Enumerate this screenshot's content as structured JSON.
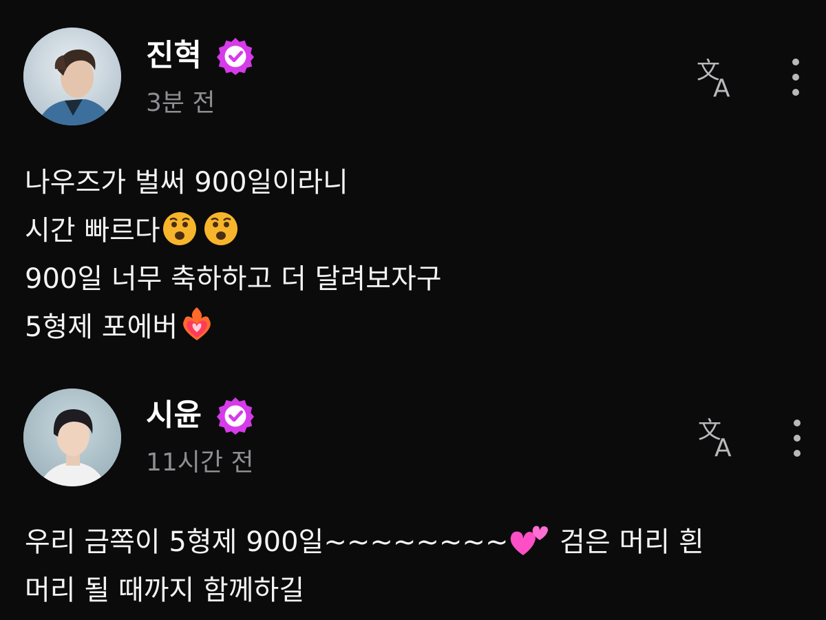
{
  "posts": [
    {
      "author": "진혁",
      "time": "3분 전",
      "lines": [
        {
          "text": "나우즈가 벌써 900일이라니",
          "emoji": []
        },
        {
          "text": "시간 빠르다",
          "emoji": [
            "anguished-face",
            "anguished-face"
          ]
        },
        {
          "text": "900일 너무 축하하고 더 달려보자구",
          "emoji": []
        },
        {
          "text": "5형제 포에버",
          "emoji": [
            "heart-on-fire"
          ]
        }
      ]
    },
    {
      "author": "시윤",
      "time": "11시간 전",
      "lines": [
        {
          "text": "우리 금쪽이 5형제 900일~~~~~~~~",
          "after": " 검은 머리 흰",
          "emoji": [
            "two-hearts"
          ]
        },
        {
          "text": "머리 될 때까지 함께하길",
          "emoji": []
        }
      ]
    }
  ],
  "icons": {
    "verified": "verified-badge-icon",
    "translate": "translate-icon",
    "more": "more-options-icon"
  },
  "colors": {
    "background": "#0b0b0c",
    "badge": "#d63be9",
    "secondary_text": "#8e8e93",
    "icon": "#b9b9bd"
  }
}
